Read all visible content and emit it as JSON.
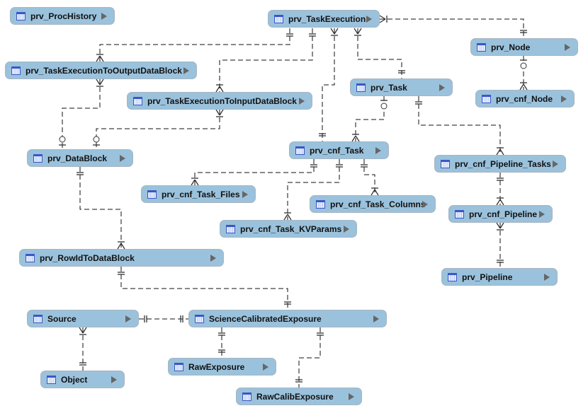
{
  "entities": [
    "prv_ProcHistory",
    "prv_TaskExecution",
    "prv_Node",
    "prv_cnf_Node",
    "prv_TaskExecutionToOutputDataBlock",
    "prv_TaskExecutionToInputDataBlock",
    "prv_Task",
    "prv_DataBlock",
    "prv_cnf_Task",
    "prv_cnf_Pipeline_Tasks",
    "prv_cnf_Task_Files",
    "prv_cnf_Task_Columns",
    "prv_cnf_Task_KVParams",
    "prv_cnf_Pipeline",
    "prv_RowIdToDataBlock",
    "prv_Pipeline",
    "Source",
    "ScienceCalibratedExposure",
    "RawExposure",
    "Object",
    "RawCalibExposure"
  ],
  "relationships": [
    {
      "from": "prv_TaskExecution",
      "to": "prv_Node",
      "from_card": "many",
      "to_card": "one"
    },
    {
      "from": "prv_TaskExecution",
      "to": "prv_TaskExecutionToOutputDataBlock",
      "from_card": "one",
      "to_card": "many"
    },
    {
      "from": "prv_TaskExecution",
      "to": "prv_TaskExecutionToInputDataBlock",
      "from_card": "one",
      "to_card": "many"
    },
    {
      "from": "prv_TaskExecution",
      "to": "prv_cnf_Task",
      "from_card": "many",
      "to_card": "one"
    },
    {
      "from": "prv_TaskExecution",
      "to": "prv_Task",
      "from_card": "many",
      "to_card": "one"
    },
    {
      "from": "prv_Node",
      "to": "prv_cnf_Node",
      "from_card": "zero-one",
      "to_card": "many"
    },
    {
      "from": "prv_TaskExecutionToOutputDataBlock",
      "to": "prv_DataBlock",
      "from_card": "many",
      "to_card": "zero-one"
    },
    {
      "from": "prv_TaskExecutionToInputDataBlock",
      "to": "prv_DataBlock",
      "from_card": "many",
      "to_card": "zero-one"
    },
    {
      "from": "prv_Task",
      "to": "prv_cnf_Task",
      "from_card": "zero-one",
      "to_card": "many"
    },
    {
      "from": "prv_Task",
      "to": "prv_cnf_Pipeline_Tasks",
      "from_card": "one",
      "to_card": "many"
    },
    {
      "from": "prv_cnf_Task",
      "to": "prv_cnf_Task_Files",
      "from_card": "one",
      "to_card": "many"
    },
    {
      "from": "prv_cnf_Task",
      "to": "prv_cnf_Task_KVParams",
      "from_card": "one",
      "to_card": "many"
    },
    {
      "from": "prv_cnf_Task",
      "to": "prv_cnf_Task_Columns",
      "from_card": "one",
      "to_card": "many"
    },
    {
      "from": "prv_cnf_Pipeline_Tasks",
      "to": "prv_cnf_Pipeline",
      "from_card": "one",
      "to_card": "many"
    },
    {
      "from": "prv_cnf_Pipeline",
      "to": "prv_Pipeline",
      "from_card": "many",
      "to_card": "one"
    },
    {
      "from": "prv_DataBlock",
      "to": "prv_RowIdToDataBlock",
      "from_card": "one",
      "to_card": "many"
    },
    {
      "from": "prv_RowIdToDataBlock",
      "to": "ScienceCalibratedExposure",
      "from_card": "one",
      "to_card": "one"
    },
    {
      "from": "Source",
      "to": "ScienceCalibratedExposure",
      "from_card": "one",
      "to_card": "one"
    },
    {
      "from": "Source",
      "to": "Object",
      "from_card": "many",
      "to_card": "one"
    },
    {
      "from": "ScienceCalibratedExposure",
      "to": "RawExposure",
      "from_card": "one",
      "to_card": "one"
    },
    {
      "from": "ScienceCalibratedExposure",
      "to": "RawCalibExposure",
      "from_card": "one",
      "to_card": "one"
    }
  ]
}
